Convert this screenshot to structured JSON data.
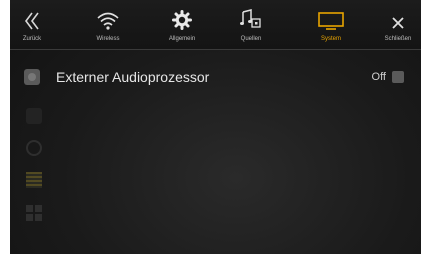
{
  "nav": {
    "back_label": "Zurück",
    "wireless_label": "Wireless",
    "general_label": "Allgemein",
    "sources_label": "Quellen",
    "system_label": "System",
    "close_label": "Schließen",
    "accent_color": "#e8a400",
    "icons": [
      "double-chevron-left-icon",
      "wifi-icon",
      "gear-icon",
      "music-source-icon",
      "monitor-icon",
      "close-icon"
    ]
  },
  "list": {
    "item_label": "Externer Audioprozessor",
    "item_value": "Off"
  }
}
